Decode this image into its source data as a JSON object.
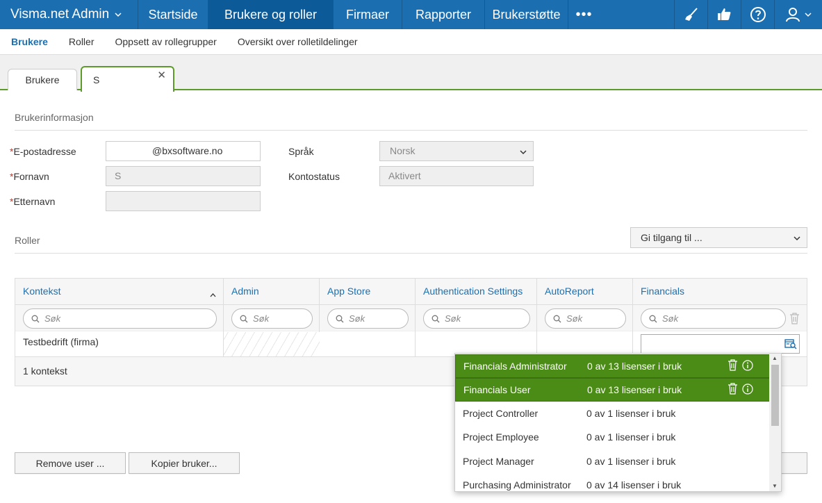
{
  "topbar": {
    "brand": "Visma.net Admin",
    "nav": [
      "Startside",
      "Brukere og roller",
      "Firmaer",
      "Rapporter",
      "Brukerstøtte"
    ],
    "more": "•••"
  },
  "subnav": [
    "Brukere",
    "Roller",
    "Oppsett av rollegrupper",
    "Oversikt over rolletildelinger"
  ],
  "tabs": {
    "tab1": "Brukere",
    "tab2": "S",
    "close": "✕"
  },
  "form": {
    "section_title": "Brukerinformasjon",
    "required_mark": "*",
    "email_label": "E-postadresse",
    "email_value": "@bxsoftware.no",
    "firstname_label": "Fornavn",
    "firstname_value": "S",
    "lastname_label": "Etternavn",
    "lastname_value": "",
    "language_label": "Språk",
    "language_value": "Norsk",
    "status_label": "Kontostatus",
    "status_value": "Aktivert"
  },
  "roles": {
    "section_title": "Roller",
    "grant_select": "Gi tilgang til ...",
    "columns": [
      "Kontekst",
      "Admin",
      "App Store",
      "Authentication Settings",
      "AutoReport",
      "Financials"
    ],
    "search_placeholder": "Søk",
    "row_context": "Testbedrift (firma)",
    "footer": "1 kontekst"
  },
  "buttons": {
    "remove": "Remove user ...",
    "copy": "Kopier bruker..."
  },
  "dropdown": [
    {
      "name": "Financials Administrator",
      "licenses": "0 av 13 lisenser i bruk",
      "selected": true
    },
    {
      "name": "Financials User",
      "licenses": "0 av 13 lisenser i bruk",
      "selected": true
    },
    {
      "name": "Project Controller",
      "licenses": "0 av 1 lisenser i bruk",
      "selected": false
    },
    {
      "name": "Project Employee",
      "licenses": "0 av 1 lisenser i bruk",
      "selected": false
    },
    {
      "name": "Project Manager",
      "licenses": "0 av 1 lisenser i bruk",
      "selected": false
    },
    {
      "name": "Purchasing Administrator",
      "licenses": "0 av 14 lisenser i bruk",
      "selected": false
    }
  ],
  "icons": {
    "broom": "broom-icon",
    "thumbs": "thumbs-icon",
    "help": "help-icon",
    "user": "user-icon",
    "trash": "trash-icon",
    "info": "info-icon",
    "search": "search-icon",
    "lookup": "lookup-icon"
  },
  "colors": {
    "topbar": "#1b6fb0",
    "active_nav": "#0d5a98",
    "accent_green": "#5c9a2a",
    "selected_row": "#4a8c15",
    "link": "#1b6fb0"
  }
}
